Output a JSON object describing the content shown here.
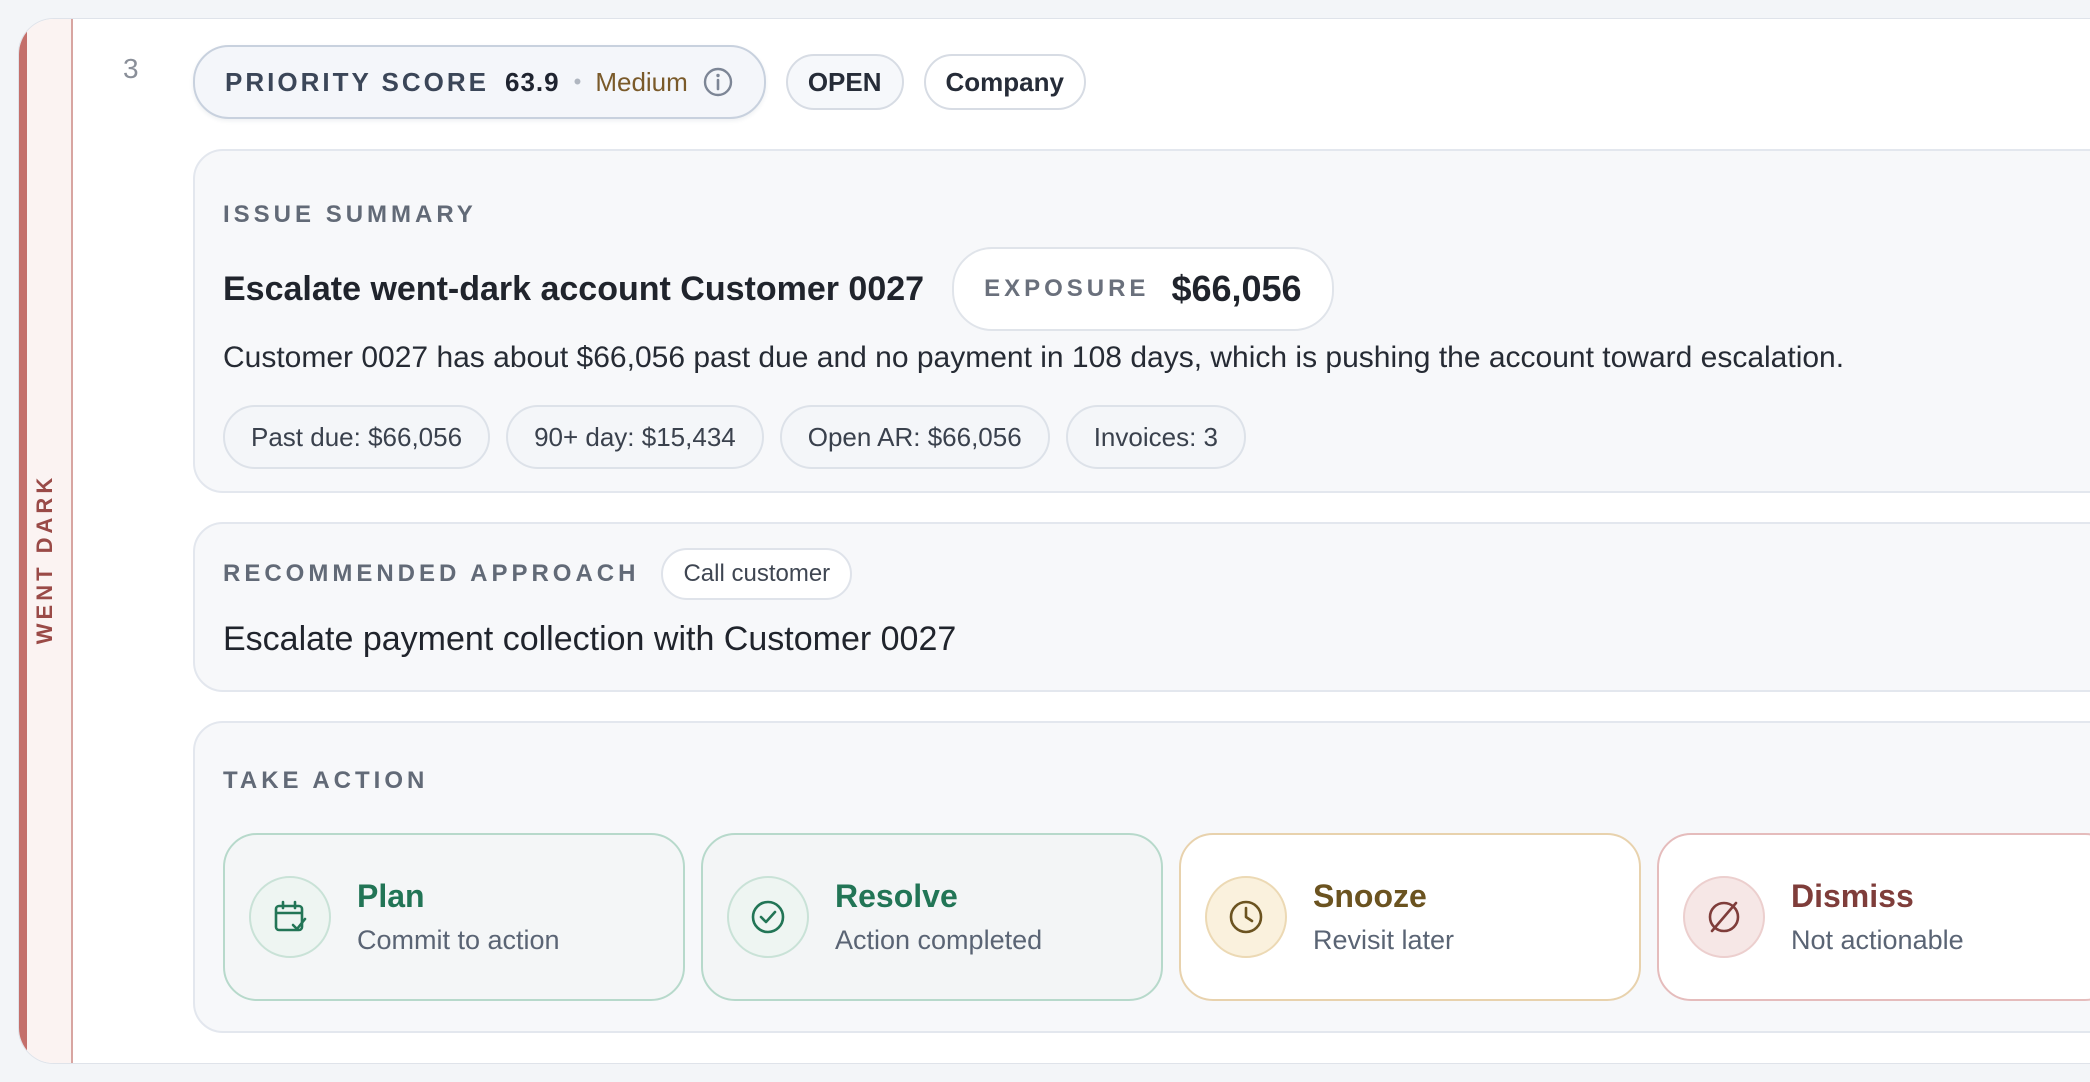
{
  "rail": {
    "label": "WENT DARK"
  },
  "rank": "3",
  "header": {
    "score_label": "PRIORITY SCORE",
    "score_value": "63.9",
    "score_level": "Medium",
    "status_tag": "OPEN",
    "entity_tag": "Company"
  },
  "issue": {
    "section_label": "ISSUE SUMMARY",
    "title": "Escalate went-dark account Customer 0027",
    "exposure_label": "EXPOSURE",
    "exposure_value": "$66,056",
    "description": "Customer 0027 has about $66,056 past due and no payment in 108 days, which is pushing the account toward escalation.",
    "chips": [
      "Past due: $66,056",
      "90+ day: $15,434",
      "Open AR: $66,056",
      "Invoices: 3"
    ]
  },
  "recommendation": {
    "section_label": "RECOMMENDED APPROACH",
    "method": "Call customer",
    "text": "Escalate payment collection with Customer 0027"
  },
  "actions": {
    "section_label": "TAKE ACTION",
    "items": [
      {
        "title": "Plan",
        "subtitle": "Commit to action",
        "icon": "calendar-check-icon"
      },
      {
        "title": "Resolve",
        "subtitle": "Action completed",
        "icon": "check-circle-icon"
      },
      {
        "title": "Snooze",
        "subtitle": "Revisit later",
        "icon": "clock-icon"
      },
      {
        "title": "Dismiss",
        "subtitle": "Not actionable",
        "icon": "slash-circle-icon"
      }
    ]
  },
  "colors": {
    "rail_accent": "#c46f6b",
    "plan": "#227556",
    "snooze": "#6b5320",
    "dismiss": "#7f3d3a"
  }
}
